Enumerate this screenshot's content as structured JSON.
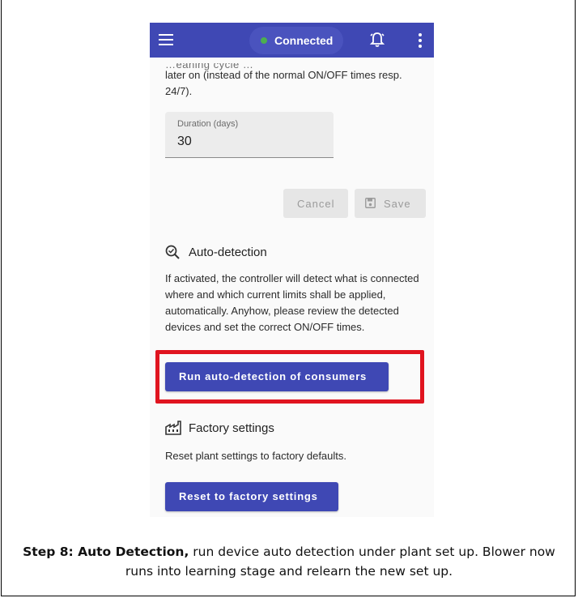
{
  "appbar": {
    "status_text": "Connected",
    "status_color": "#4caf50",
    "bar_color": "#3f48b4",
    "icons": [
      "menu-icon",
      "bell-icon",
      "more-vert-icon"
    ]
  },
  "schedule": {
    "partial_text": "…eaning     cycle      …",
    "text": "later on (instead of the normal ON/OFF times resp. 24/7).",
    "duration_label": "Duration (days)",
    "duration_value": "30",
    "cancel_label": "Cancel",
    "save_label": "Save"
  },
  "auto_detection": {
    "title": "Auto-detection",
    "description": "If activated, the controller will detect what is connected where and which current limits shall be applied, automatically. Anyhow, please review the detected devices and set the correct ON/OFF times.",
    "button_label": "Run auto-detection of consumers",
    "highlight_color": "#e0141f"
  },
  "factory": {
    "title": "Factory settings",
    "description": "Reset plant settings to factory defaults.",
    "button_label": "Reset to factory settings"
  },
  "caption": {
    "bold": "Step 8: Auto Detection,",
    "text": " run device auto detection under plant set up. Blower now runs into learning stage and relearn the new set up."
  }
}
